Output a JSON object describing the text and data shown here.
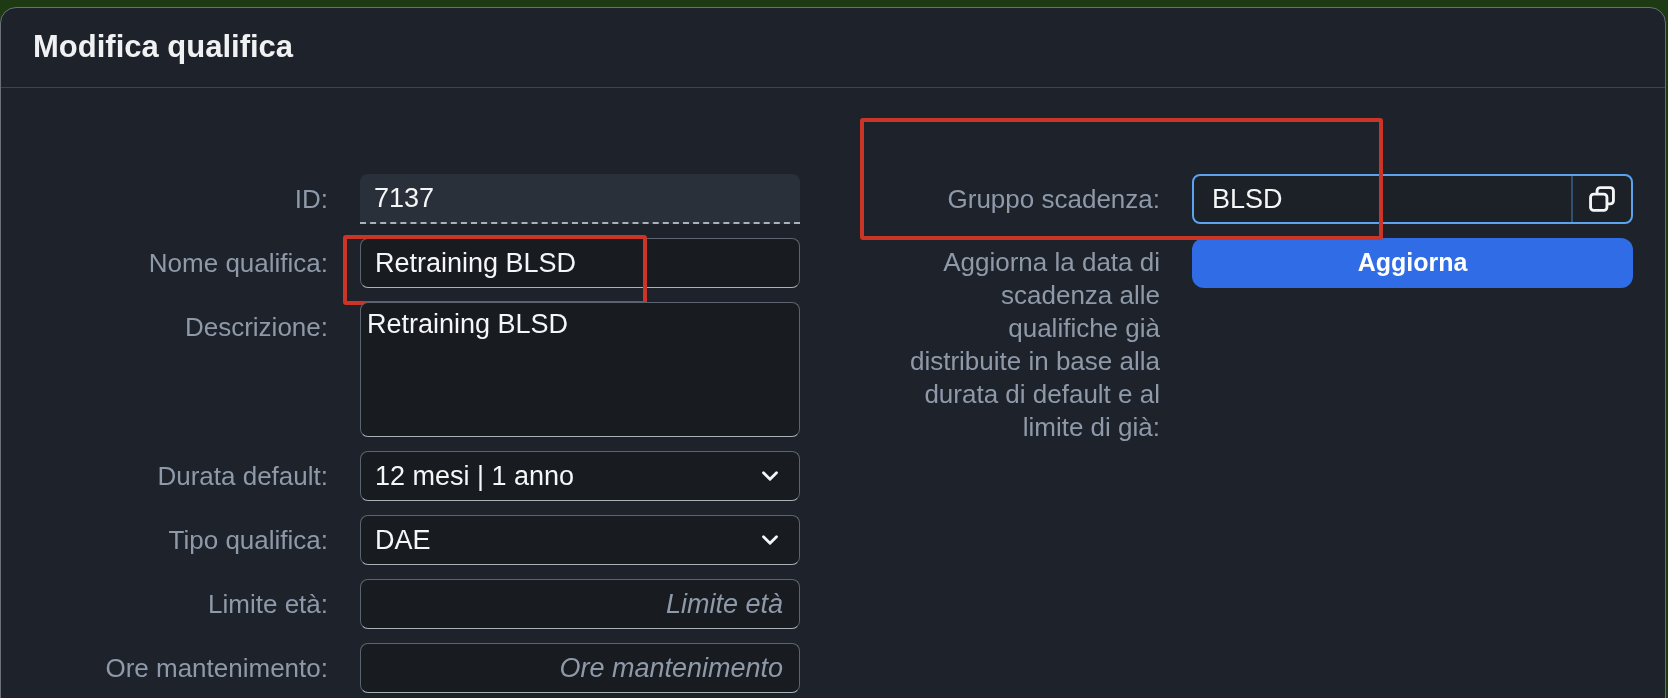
{
  "dialog": {
    "title": "Modifica qualifica"
  },
  "fields": [
    {
      "kind": "readonly",
      "label": "ID:",
      "value": "7137",
      "highlighted": false
    },
    {
      "kind": "text",
      "label": "Nome qualifica:",
      "value": "Retraining BLSD",
      "highlighted": true
    },
    {
      "kind": "textarea",
      "label": "Descrizione:",
      "value": "Retraining BLSD",
      "highlighted": false
    },
    {
      "kind": "select",
      "label": "Durata default:",
      "value": "12 mesi | 1 anno",
      "highlighted": false
    },
    {
      "kind": "select",
      "label": "Tipo qualifica:",
      "value": "DAE",
      "highlighted": false
    },
    {
      "kind": "number",
      "label": "Limite età:",
      "placeholder": "Limite età",
      "highlighted": false
    },
    {
      "kind": "number",
      "label": "Ore mantenimento:",
      "placeholder": "Ore mantenimento",
      "highlighted": false
    }
  ],
  "expiry_group": {
    "label": "Gruppo scadenza:",
    "value": "BLSD",
    "focused": true,
    "highlighted": true
  },
  "update": {
    "description": "Aggiorna la data di scadenza alle qualifiche già distribuite in base alla durata di default e al limite di già:",
    "button": "Aggiorna"
  }
}
